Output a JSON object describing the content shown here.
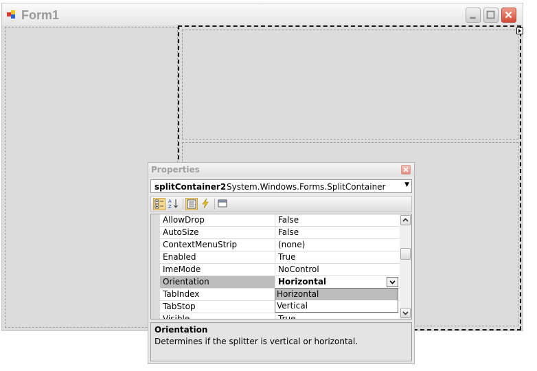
{
  "form": {
    "title": "Form1"
  },
  "properties": {
    "title": "Properties",
    "object_name": "splitContainer2",
    "object_type": "System.Windows.Forms.SplitContainer",
    "rows": [
      {
        "name": "AllowDrop",
        "value": "False"
      },
      {
        "name": "AutoSize",
        "value": "False"
      },
      {
        "name": "ContextMenuStrip",
        "value": "(none)"
      },
      {
        "name": "Enabled",
        "value": "True"
      },
      {
        "name": "ImeMode",
        "value": "NoControl"
      },
      {
        "name": "Orientation",
        "value": "Horizontal"
      },
      {
        "name": "TabIndex",
        "value": ""
      },
      {
        "name": "TabStop",
        "value": ""
      },
      {
        "name": "Visible",
        "value": "True"
      }
    ],
    "dropdown_options": [
      "Horizontal",
      "Vertical"
    ],
    "description": {
      "title": "Orientation",
      "text": "Determines if the splitter is vertical or horizontal."
    }
  },
  "colors": {
    "selection": "#bcbcbc",
    "close_accent": "#d14a35",
    "toolbar_active": "#f6d98e"
  }
}
